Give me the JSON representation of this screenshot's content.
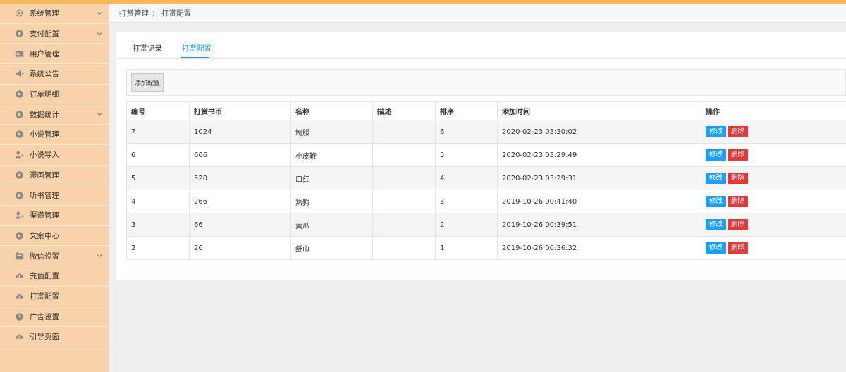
{
  "sidebar": {
    "items": [
      {
        "label": "系统管理",
        "icon": "gear-icon",
        "expandable": true
      },
      {
        "label": "支付配置",
        "icon": "circle-icon",
        "expandable": true
      },
      {
        "label": "用户管理",
        "icon": "id-card-icon",
        "expandable": false
      },
      {
        "label": "系统公告",
        "icon": "megaphone-icon",
        "expandable": false
      },
      {
        "label": "订单明细",
        "icon": "circle-icon",
        "expandable": false
      },
      {
        "label": "数据统计",
        "icon": "circle-icon",
        "expandable": true
      },
      {
        "label": "小说管理",
        "icon": "circle-icon",
        "expandable": false
      },
      {
        "label": "小说导入",
        "icon": "user-plus-icon",
        "expandable": false
      },
      {
        "label": "漫画管理",
        "icon": "circle-icon",
        "expandable": false
      },
      {
        "label": "听书管理",
        "icon": "circle-icon",
        "expandable": false
      },
      {
        "label": "渠道管理",
        "icon": "user-plus-icon",
        "expandable": false
      },
      {
        "label": "文案中心",
        "icon": "circle-icon",
        "expandable": false
      },
      {
        "label": "微信设置",
        "icon": "wechat-icon",
        "expandable": true
      },
      {
        "label": "充值配置",
        "icon": "cloud-download-icon",
        "expandable": false
      },
      {
        "label": "打赏配置",
        "icon": "cloud-download-icon",
        "expandable": false
      },
      {
        "label": "广告设置",
        "icon": "clock-icon",
        "expandable": false
      },
      {
        "label": "引导页面",
        "icon": "cloud-download-icon",
        "expandable": false
      }
    ]
  },
  "breadcrumb": {
    "parent": "打赏管理",
    "separator": "〉",
    "current": "打赏配置"
  },
  "tabs": [
    {
      "label": "打赏记录"
    },
    {
      "label": "打赏配置"
    }
  ],
  "toolbar": {
    "add_label": "添加配置"
  },
  "table": {
    "headers": [
      "编号",
      "打赏书币",
      "名称",
      "描述",
      "排序",
      "添加时间",
      "操作"
    ],
    "rows": [
      {
        "id": "7",
        "coins": "1024",
        "name": "制服",
        "desc": "",
        "sort": "6",
        "time": "2020-02-23 03:30:02"
      },
      {
        "id": "6",
        "coins": "666",
        "name": "小皮鞭",
        "desc": "",
        "sort": "5",
        "time": "2020-02-23 03:29:49"
      },
      {
        "id": "5",
        "coins": "520",
        "name": "口红",
        "desc": "",
        "sort": "4",
        "time": "2020-02-23 03:29:31"
      },
      {
        "id": "4",
        "coins": "266",
        "name": "热狗",
        "desc": "",
        "sort": "3",
        "time": "2019-10-26 00:41:40"
      },
      {
        "id": "3",
        "coins": "66",
        "name": "黄瓜",
        "desc": "",
        "sort": "2",
        "time": "2019-10-26 00:39:51"
      },
      {
        "id": "2",
        "coins": "26",
        "name": "纸巾",
        "desc": "",
        "sort": "1",
        "time": "2019-10-26 00:36:32"
      }
    ],
    "edit_label": "修改",
    "delete_label": "删除"
  },
  "colors": {
    "accent": "#1e9fff",
    "danger": "#e2393b",
    "sidebar": "#f7d2aa",
    "topbar": "#f5b65c"
  }
}
